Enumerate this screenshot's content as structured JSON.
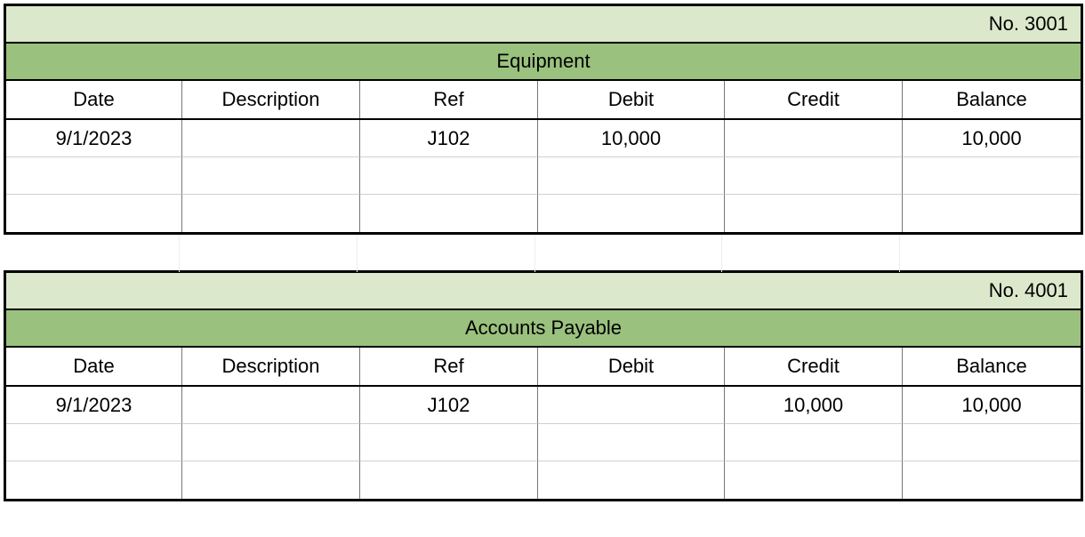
{
  "columns": [
    "Date",
    "Description",
    "Ref",
    "Debit",
    "Credit",
    "Balance"
  ],
  "ledgers": [
    {
      "no_label": "No. 3001",
      "title": "Equipment",
      "rows": [
        {
          "date": "9/1/2023",
          "description": "",
          "ref": "J102",
          "debit": "10,000",
          "credit": "",
          "balance": "10,000"
        },
        {
          "date": "",
          "description": "",
          "ref": "",
          "debit": "",
          "credit": "",
          "balance": ""
        },
        {
          "date": "",
          "description": "",
          "ref": "",
          "debit": "",
          "credit": "",
          "balance": ""
        }
      ]
    },
    {
      "no_label": "No. 4001",
      "title": "Accounts Payable",
      "rows": [
        {
          "date": "9/1/2023",
          "description": "",
          "ref": "J102",
          "debit": "",
          "credit": "10,000",
          "balance": "10,000"
        },
        {
          "date": "",
          "description": "",
          "ref": "",
          "debit": "",
          "credit": "",
          "balance": ""
        },
        {
          "date": "",
          "description": "",
          "ref": "",
          "debit": "",
          "credit": "",
          "balance": ""
        }
      ]
    }
  ]
}
